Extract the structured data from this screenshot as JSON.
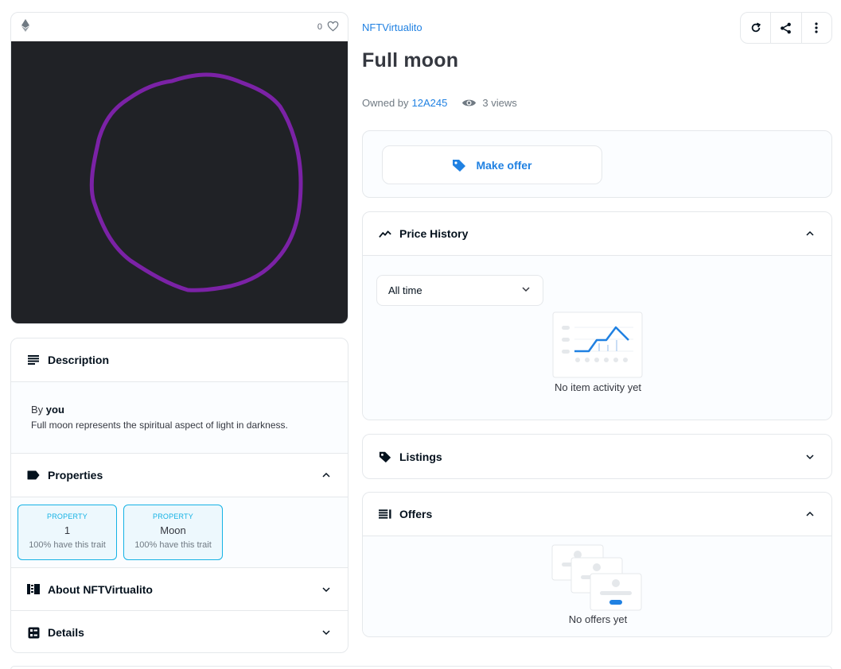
{
  "media": {
    "favorite_count": "0",
    "chain_icon": "ethereum-icon",
    "like_icon": "heart-icon",
    "artwork_color": "#7b22a6",
    "background_color": "#202226"
  },
  "collection": {
    "name": "NFTVirtualito"
  },
  "item": {
    "title": "Full moon",
    "owned_by_label": "Owned by",
    "owner": "12A245",
    "views": "3 views"
  },
  "actions": {
    "icons": [
      "refresh-icon",
      "share-icon",
      "more-icon"
    ]
  },
  "offer": {
    "make_offer_label": "Make offer"
  },
  "description": {
    "title": "Description",
    "by_label": "By",
    "creator": "you",
    "text": "Full moon represents the spiritual aspect of light in darkness."
  },
  "properties": {
    "title": "Properties",
    "items": [
      {
        "type": "PROPERTY",
        "value": "1",
        "rarity": "100% have this trait"
      },
      {
        "type": "PROPERTY",
        "value": "Moon",
        "rarity": "100% have this trait"
      }
    ]
  },
  "about": {
    "title": "About NFTVirtualito"
  },
  "details": {
    "title": "Details"
  },
  "price_history": {
    "title": "Price History",
    "range_selected": "All time",
    "empty_text": "No item activity yet"
  },
  "listings": {
    "title": "Listings"
  },
  "offers": {
    "title": "Offers",
    "empty_text": "No offers yet"
  },
  "colors": {
    "accent": "#2081e2",
    "property_border": "#15b2e5",
    "text": "#353840",
    "border": "#e5e8eb"
  }
}
